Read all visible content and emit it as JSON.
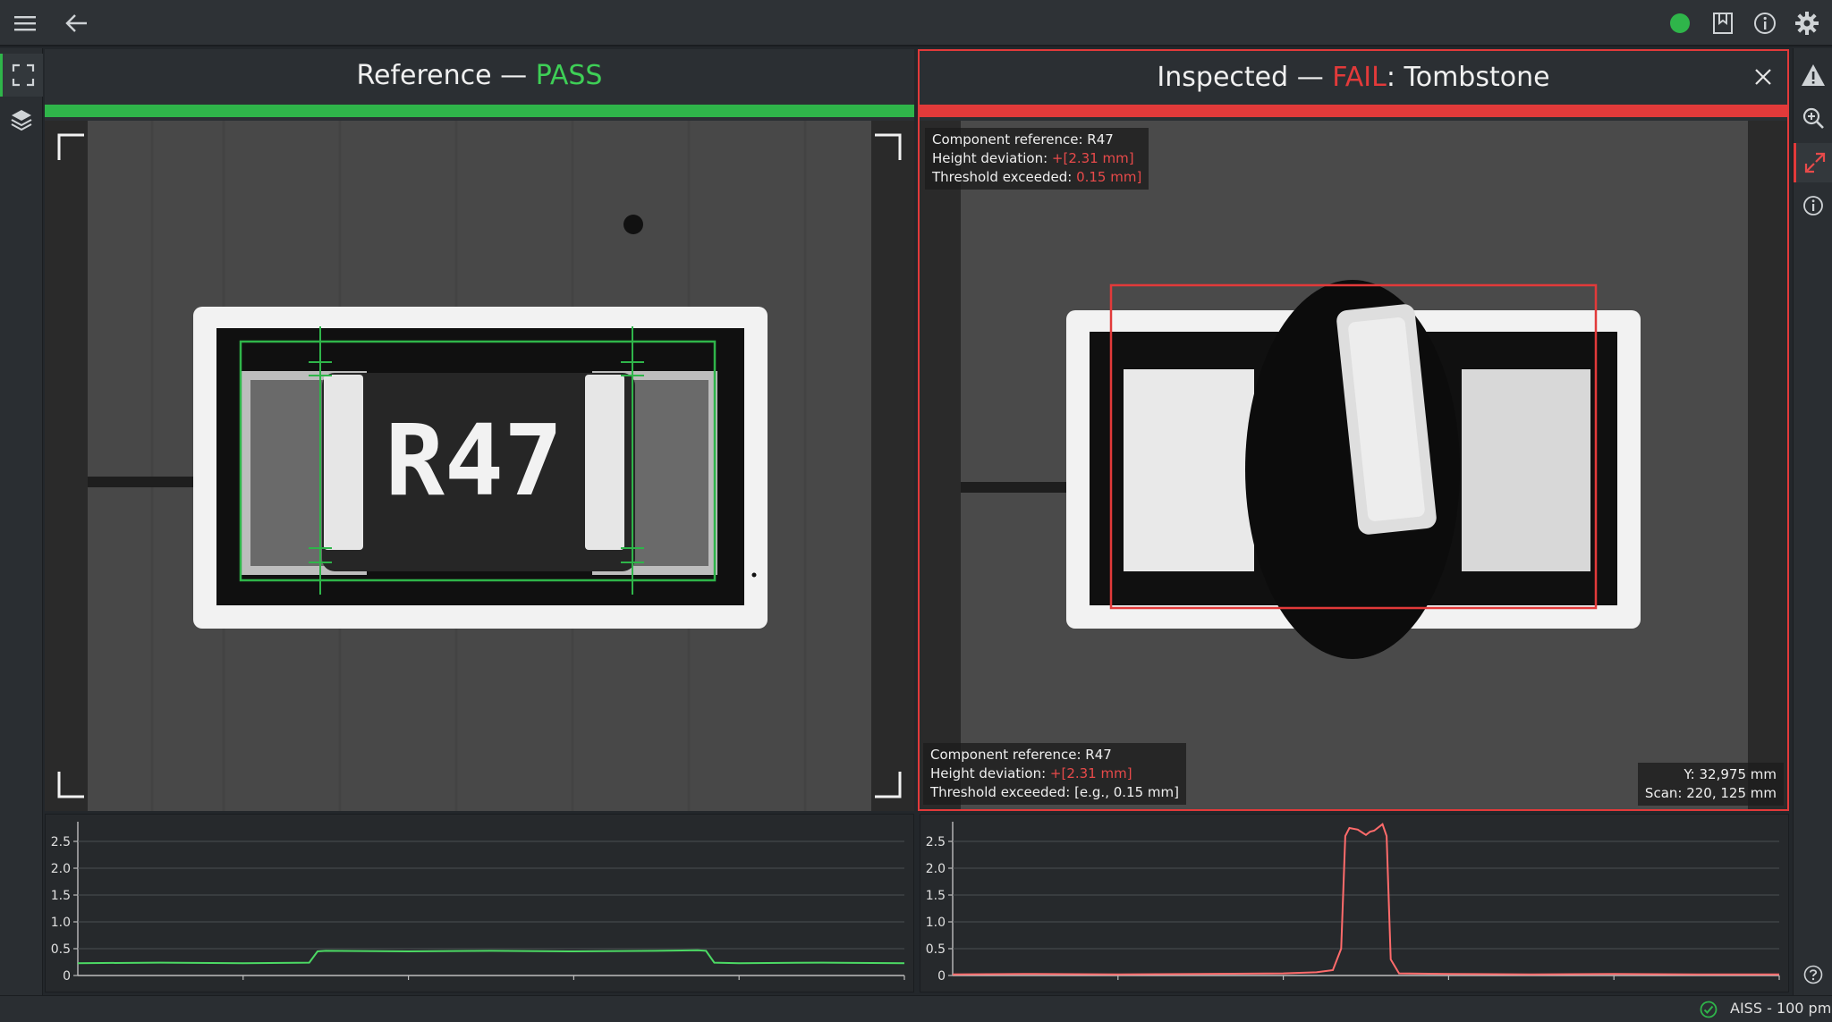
{
  "topbar": {
    "icons": [
      "menu-icon",
      "back-arrow-icon",
      "status-dot-icon",
      "bookmark-icon",
      "info-icon",
      "gear-icon"
    ],
    "status_color": "#2fb54a"
  },
  "left_panel": {
    "title_prefix": "Reference — ",
    "title_status": "PASS",
    "status_color": "#2fb54a",
    "component_print": "R47"
  },
  "right_panel": {
    "title_prefix": "Inspected — ",
    "title_status": "FAIL",
    "title_suffix": ": Tombstone",
    "status_color": "#e23a3a",
    "info_top": {
      "line1": "Component reference: R47",
      "line2_label": "Height deviation: ",
      "line2_value": "+[2.31 mm]",
      "line3_label": "Threshold exceeded: ",
      "line3_value": "0.15 mm]"
    },
    "info_bottom": {
      "line1": "Component reference: R47",
      "line2_label": "Height deviation: ",
      "line2_value": "+[2.31 mm]",
      "line3": "Threshold exceeded: [e.g., 0.15 mm]"
    },
    "coords": {
      "line1": "Y:   32,975 mm",
      "line2": "Scan: 220, 125 mm"
    }
  },
  "chart_data": [
    {
      "type": "line",
      "title": "",
      "xlabel": "",
      "ylabel": "",
      "ylim": [
        0,
        2.8
      ],
      "yticks": [
        "0",
        "0.5",
        "1.0",
        "1.5",
        "2.0",
        "2.5"
      ],
      "ytick_values": [
        0,
        0.5,
        1.0,
        1.5,
        2.0,
        2.5
      ],
      "grid": true,
      "color": "#4cd964",
      "series": [
        {
          "x": [
            0,
            0.1,
            0.2,
            0.28,
            0.29,
            0.3,
            0.4,
            0.5,
            0.6,
            0.7,
            0.75,
            0.76,
            0.77,
            0.8,
            0.9,
            1.0
          ],
          "values": [
            0.23,
            0.24,
            0.23,
            0.24,
            0.45,
            0.46,
            0.45,
            0.46,
            0.45,
            0.46,
            0.47,
            0.46,
            0.24,
            0.23,
            0.24,
            0.23
          ]
        }
      ]
    },
    {
      "type": "line",
      "title": "",
      "xlabel": "",
      "ylabel": "",
      "ylim": [
        0,
        2.8
      ],
      "yticks": [
        "0",
        "0.5",
        "1.0",
        "1.5",
        "2.0",
        "2.5"
      ],
      "ytick_values": [
        0,
        0.5,
        1.0,
        1.5,
        2.0,
        2.5
      ],
      "grid": true,
      "color": "#ff6b6b",
      "series": [
        {
          "x": [
            0,
            0.1,
            0.2,
            0.3,
            0.4,
            0.44,
            0.46,
            0.47,
            0.475,
            0.48,
            0.49,
            0.5,
            0.505,
            0.51,
            0.52,
            0.525,
            0.53,
            0.54,
            0.6,
            0.7,
            0.8,
            0.9,
            1.0
          ],
          "values": [
            0.02,
            0.03,
            0.02,
            0.03,
            0.04,
            0.06,
            0.1,
            0.5,
            2.6,
            2.75,
            2.72,
            2.62,
            2.68,
            2.7,
            2.82,
            2.6,
            0.3,
            0.04,
            0.03,
            0.02,
            0.03,
            0.02,
            0.02
          ]
        }
      ]
    }
  ],
  "statusbar": {
    "label": "AISS - 100 pm",
    "icon": "check-circle-icon",
    "icon_color": "#2fb54a"
  }
}
